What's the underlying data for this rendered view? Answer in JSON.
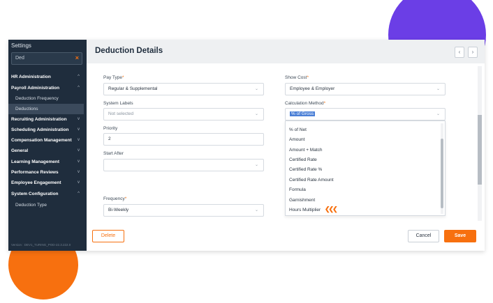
{
  "sidebar": {
    "title": "Settings",
    "search_value": "Ded",
    "clear_icon": "×",
    "items": [
      {
        "label": "HR Administration",
        "chevron": "^"
      },
      {
        "label": "Payroll Administration",
        "chevron": "^"
      },
      {
        "label": "Deduction Frequency"
      },
      {
        "label": "Deductions"
      },
      {
        "label": "Recruiting Administration",
        "chevron": "v"
      },
      {
        "label": "Scheduling Administration",
        "chevron": "v"
      },
      {
        "label": "Compensation Management",
        "chevron": "v"
      },
      {
        "label": "General",
        "chevron": "v"
      },
      {
        "label": "Learning Management",
        "chevron": "v"
      },
      {
        "label": "Performance Reviews",
        "chevron": "v"
      },
      {
        "label": "Employee Engagement",
        "chevron": "v"
      },
      {
        "label": "System Configuration",
        "chevron": "^"
      },
      {
        "label": "Deduction Type"
      }
    ],
    "version": "Version : DEV1_TURING_POD-22.3.222.0"
  },
  "header": {
    "title": "Deduction Details",
    "prev": "‹",
    "next": "›"
  },
  "form": {
    "pay_type": {
      "label": "Pay Type",
      "value": "Regular & Supplemental"
    },
    "show_cost": {
      "label": "Show Cost",
      "value": "Employee & Employer"
    },
    "system_labels": {
      "label": "System Labels",
      "placeholder": "Not selected"
    },
    "calculation_method": {
      "label": "Calculation Method",
      "value": "% of Gross"
    },
    "priority": {
      "label": "Priority",
      "value": "2"
    },
    "start_after": {
      "label": "Start After"
    },
    "frequency": {
      "label": "Frequency",
      "value": "Bi-Weekly"
    },
    "required_mark": "*",
    "caret": "⌄"
  },
  "dropdown": {
    "options": [
      "% of Net",
      "Amount",
      "Amount + Match",
      "Certified Rate",
      "Certified Rate %",
      "Certified Rate Amount",
      "Formula",
      "Garnishment",
      "Hours Multiplier"
    ],
    "pointer_icon": "arrow-marker-icon",
    "pointer_glyph": "❮❮❮"
  },
  "actions": {
    "delete": "Delete",
    "cancel": "Cancel",
    "save": "Save"
  },
  "colors": {
    "accent": "#f7700f",
    "sidebar_bg": "#1f2d3d",
    "decor_purple": "#6b3ee6",
    "selection": "#4a7fd6"
  }
}
